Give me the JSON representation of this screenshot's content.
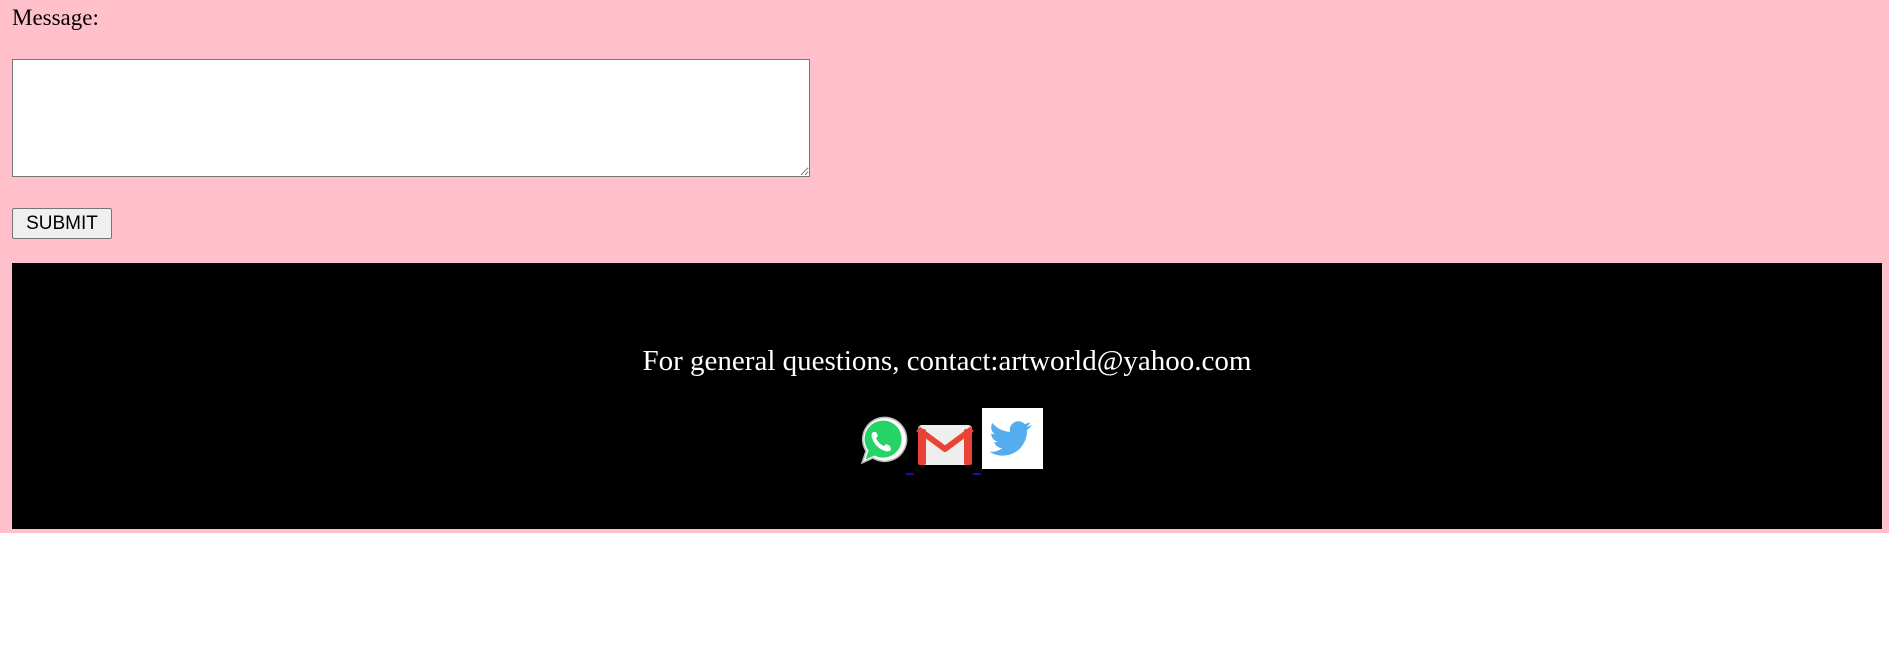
{
  "form": {
    "message_label": "Message:",
    "message_value": "",
    "submit_label": "SUBMIT"
  },
  "footer": {
    "contact_text": "For general questions, contact:artworld@yahoo.com",
    "social_links": [
      {
        "icon": "whatsapp-icon",
        "color": "#25d366"
      },
      {
        "icon": "gmail-icon",
        "color": "#ea4335"
      },
      {
        "icon": "twitter-icon",
        "color": "#55acee"
      }
    ]
  },
  "colors": {
    "page_background": "#ffc0cb",
    "footer_background": "#000000",
    "footer_text": "#ffffff"
  }
}
